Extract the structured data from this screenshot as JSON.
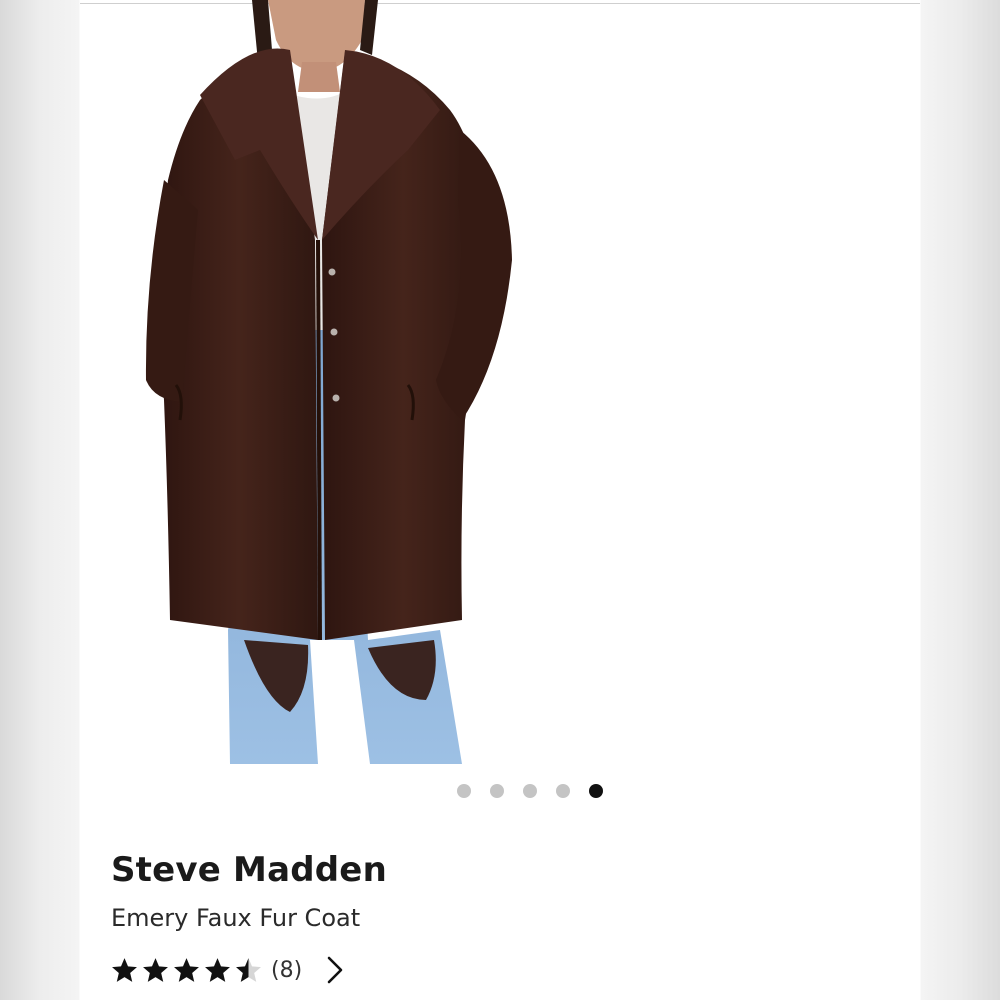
{
  "product": {
    "brand": "Steve Madden",
    "name": "Emery Faux Fur Coat",
    "rating": 4.5,
    "rating_max": 5,
    "review_count_label": "(8)"
  },
  "carousel": {
    "total_images": 5,
    "active_index": 4
  },
  "icons": {
    "star": "star-icon",
    "chevron": "chevron-right-icon"
  },
  "colors": {
    "coat": "#3b1f18",
    "star": "#111111",
    "dot_active": "#111111",
    "dot_inactive": "#c4c4c4"
  }
}
